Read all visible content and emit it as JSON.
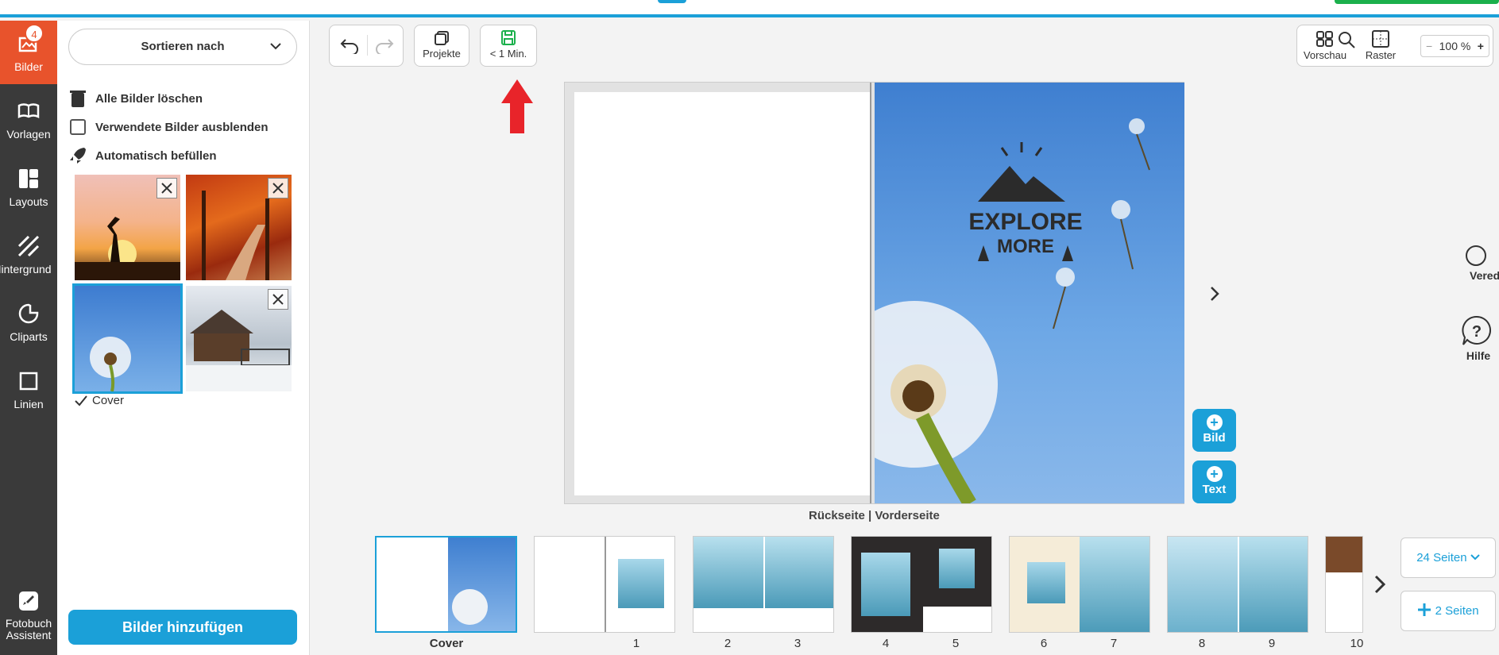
{
  "topbar": {
    "link_text": "..."
  },
  "rail": {
    "badge": "4",
    "items": [
      {
        "label": "Bilder"
      },
      {
        "label": "Vorlagen"
      },
      {
        "label": "Layouts"
      },
      {
        "label": "Hintergrund"
      },
      {
        "label": "Cliparts"
      },
      {
        "label": "Linien"
      },
      {
        "label": "Fotobuch Assistent"
      }
    ]
  },
  "panel": {
    "sort_label": "Sortieren nach",
    "options": {
      "delete_all": "Alle Bilder löschen",
      "hide_used": "Verwendete Bilder ausblenden",
      "autofill": "Automatisch befüllen"
    },
    "cover_label": "Cover",
    "add_button": "Bilder hinzufügen"
  },
  "toolbar": {
    "projects": "Projekte",
    "save": "< 1 Min.",
    "preview": "Vorschau",
    "grid": "Raster",
    "zoom": "100 %",
    "zoom_minus": "−",
    "zoom_plus": "+"
  },
  "canvas": {
    "cover_text_line1": "EXPLORE",
    "cover_text_line2": "MORE",
    "spread_label": "Rückseite | Vorderseite",
    "add_image": "Bild",
    "add_text": "Text"
  },
  "right_panel": {
    "finishing": "Veredelung",
    "help": "Hilfe"
  },
  "pages": {
    "labels": [
      "Cover",
      "1",
      "2",
      "3",
      "4",
      "5",
      "6",
      "7",
      "8",
      "9",
      "10"
    ],
    "page_count": "24 Seiten",
    "add_pages": "2 Seiten"
  },
  "colors": {
    "accent": "#1ba0d8",
    "active_rail": "#e8532c",
    "rail_bg": "#3a3a3a",
    "save_icon": "#1bb04c",
    "arrow": "#e8242a"
  }
}
